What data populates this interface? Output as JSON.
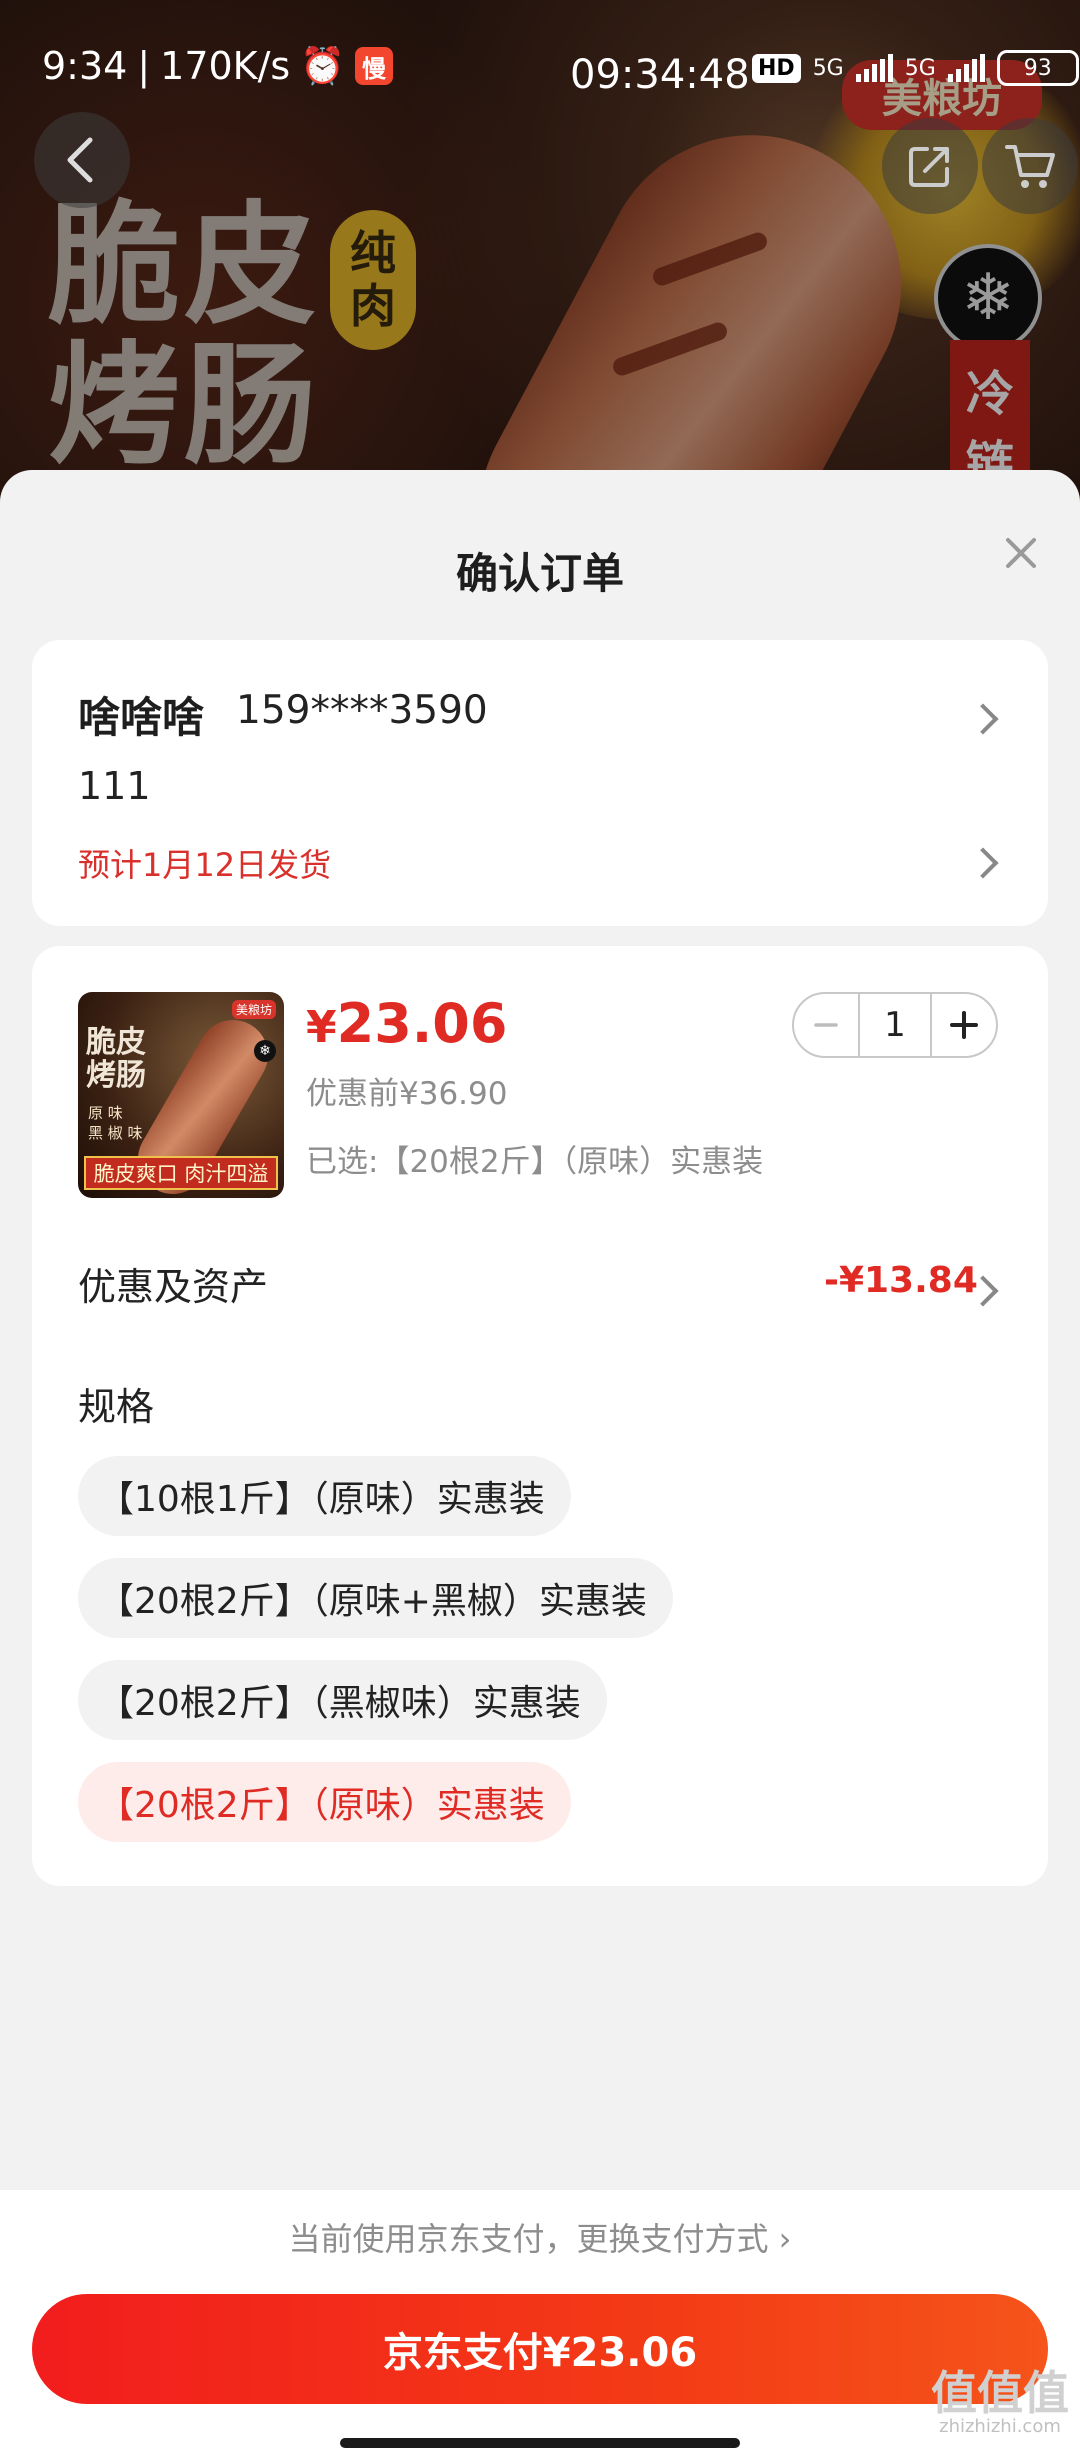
{
  "status_bar": {
    "time": "9:34",
    "net_speed": "170K/s",
    "slow_badge": "慢",
    "clock": "09:34:48",
    "hd_label": "HD",
    "net_label_1": "5G",
    "net_label_2": "5G",
    "battery": "93"
  },
  "banner": {
    "line1": "脆皮",
    "line2": "烤肠",
    "badge_top": "纯",
    "badge_bottom": "肉",
    "brand": "美粮坊",
    "cold_1": "冷",
    "cold_2": "链"
  },
  "sheet": {
    "title": "确认订单"
  },
  "address": {
    "name": "啥啥啥",
    "phone": "159****3590",
    "detail": "111",
    "shipping_estimate": "预计1月12日发货"
  },
  "product": {
    "thumb_title_1": "脆皮",
    "thumb_title_2": "烤肠",
    "thumb_sub": "原 味\n黑 椒 味",
    "thumb_banner": "脆皮爽口 肉汁四溢",
    "thumb_logo": "美粮坊",
    "price_symbol": "¥",
    "price": "23.06",
    "original_price": "优惠前¥36.90",
    "selected_spec": "已选:【20根2斤】（原味）实惠装",
    "quantity": "1"
  },
  "discount": {
    "label": "优惠及资产",
    "value": "-¥13.84"
  },
  "spec": {
    "title": "规格",
    "options": [
      {
        "label": "【10根1斤】（原味）实惠装",
        "active": false
      },
      {
        "label": "【20根2斤】（原味+黑椒）实惠装",
        "active": false
      },
      {
        "label": "【20根2斤】（黑椒味）实惠装",
        "active": false
      },
      {
        "label": "【20根2斤】（原味）实惠装",
        "active": true
      }
    ]
  },
  "payment": {
    "switch_text": "当前使用京东支付，更换支付方式 ›",
    "pay_button": "京东支付¥23.06"
  },
  "watermark": {
    "big": "值值值",
    "small": "zhizhizhi.com"
  },
  "colors": {
    "accent_red": "#e02a24",
    "pay_gradient_start": "#f21d1d",
    "pay_gradient_end": "#f5541a"
  }
}
